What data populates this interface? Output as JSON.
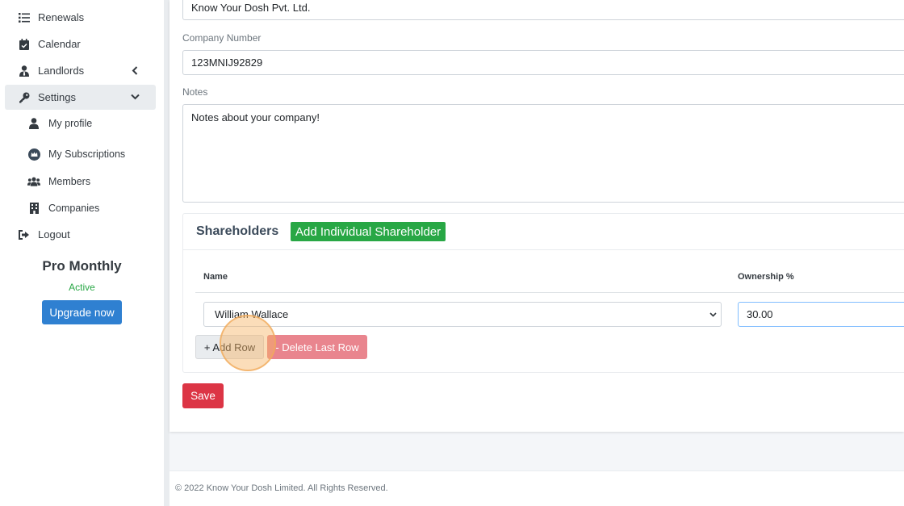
{
  "sidebar": {
    "items": [
      {
        "label": "Renewals",
        "icon": "list-icon"
      },
      {
        "label": "Calendar",
        "icon": "calendar-icon"
      },
      {
        "label": "Landlords",
        "icon": "user-tie-icon"
      },
      {
        "label": "Settings",
        "icon": "key-icon"
      }
    ],
    "sub_items": [
      {
        "label": "My profile",
        "icon": "user-icon"
      },
      {
        "label": "My Subscriptions",
        "icon": "crown-icon"
      },
      {
        "label": "Members",
        "icon": "users-icon"
      },
      {
        "label": "Companies",
        "icon": "building-icon"
      }
    ],
    "logout": {
      "label": "Logout",
      "icon": "sign-out-icon"
    },
    "plan": {
      "name": "Pro Monthly",
      "status": "Active",
      "upgrade_label": "Upgrade now"
    }
  },
  "form": {
    "company_name_value": "Know Your Dosh Pvt. Ltd.",
    "company_number_label": "Company Number",
    "company_number_value": "123MNIJ92829",
    "notes_label": "Notes",
    "notes_value": "Notes about your company!",
    "save_label": "Save"
  },
  "shareholders": {
    "title": "Shareholders",
    "add_individual_label": "Add Individual Shareholder",
    "columns": [
      "Name",
      "Ownership %"
    ],
    "rows": [
      {
        "name": "William Wallace",
        "ownership": "30.00"
      }
    ],
    "add_row_label": "+ Add Row",
    "delete_row_label": "- Delete Last Row"
  },
  "footer": {
    "text": "© 2022 Know Your Dosh Limited. All Rights Reserved."
  },
  "colors": {
    "primary": "#2f80d1",
    "success": "#28a745",
    "danger": "#dc3545",
    "highlight": "#f6b364"
  }
}
